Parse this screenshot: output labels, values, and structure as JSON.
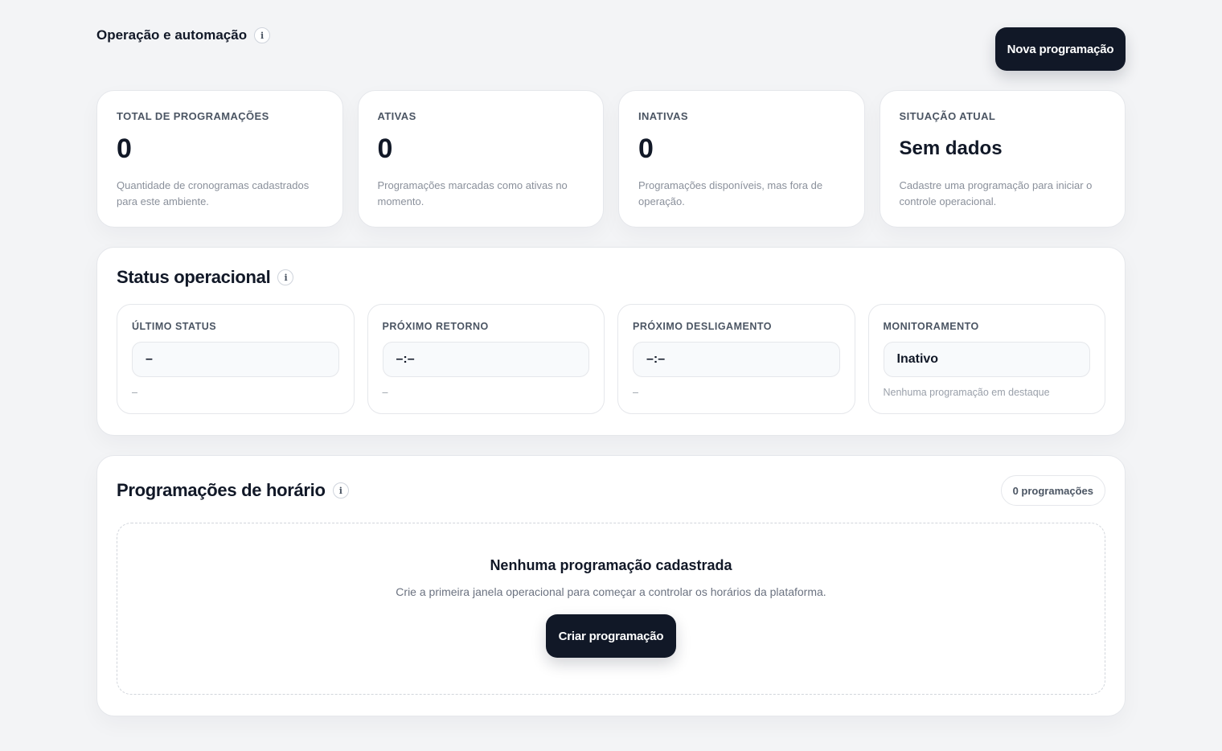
{
  "header": {
    "title": "Operação e automação",
    "new_button": "Nova programação"
  },
  "stats": [
    {
      "label": "TOTAL DE PROGRAMAÇÕES",
      "value": "0",
      "description": "Quantidade de cronogramas cadastrados para este ambiente."
    },
    {
      "label": "ATIVAS",
      "value": "0",
      "description": "Programações marcadas como ativas no momento."
    },
    {
      "label": "INATIVAS",
      "value": "0",
      "description": "Programações disponíveis, mas fora de operação."
    },
    {
      "label": "SITUAÇÃO ATUAL",
      "value": "Sem dados",
      "description": "Cadastre uma programação para iniciar o controle operacional."
    }
  ],
  "status_section": {
    "title": "Status operacional",
    "items": [
      {
        "label": "ÚLTIMO STATUS",
        "value": "–",
        "note": "–"
      },
      {
        "label": "PRÓXIMO RETORNO",
        "value": "–:–",
        "note": "–"
      },
      {
        "label": "PRÓXIMO DESLIGAMENTO",
        "value": "–:–",
        "note": "–"
      },
      {
        "label": "MONITORAMENTO",
        "value": "Inativo",
        "note": "Nenhuma programação em destaque"
      }
    ]
  },
  "schedule_section": {
    "title": "Programações de horário",
    "count_badge": "0 programações",
    "empty_title": "Nenhuma programação cadastrada",
    "empty_description": "Crie a primeira janela operacional para começar a controlar os horários da plataforma.",
    "create_button": "Criar programação"
  },
  "icons": {
    "info": "info-icon"
  },
  "colors": {
    "background": "#f3f4f6",
    "card": "#ffffff",
    "primary_button": "#111827",
    "muted_text": "#8a909b"
  }
}
